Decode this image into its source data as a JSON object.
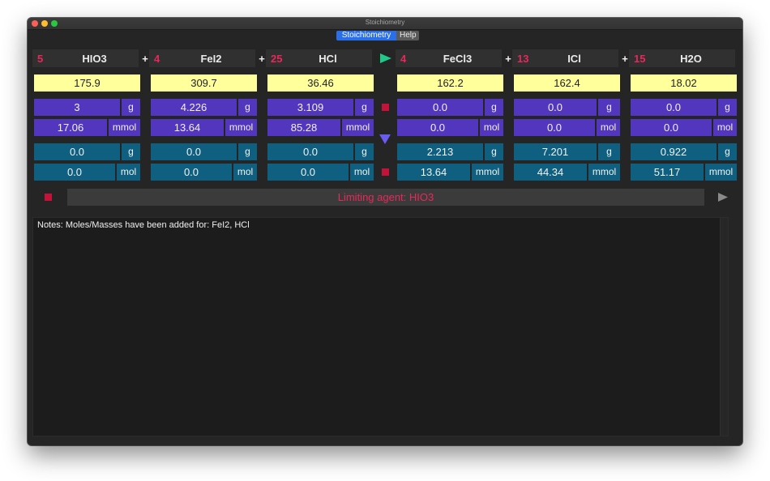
{
  "window": {
    "title": "Stoichiometry"
  },
  "tabs": [
    {
      "label": "Stoichiometry",
      "active": true
    },
    {
      "label": "Help",
      "active": false
    }
  ],
  "plus_sign": "+",
  "reactants": [
    {
      "coef": "5",
      "formula": "HIO3",
      "mw": "175.9",
      "mass": "3",
      "mass_unit": "g",
      "moles": "17.06",
      "moles_unit": "mmol",
      "calc_mass": "0.0",
      "calc_mass_unit": "g",
      "calc_moles": "0.0",
      "calc_moles_unit": "mol"
    },
    {
      "coef": "4",
      "formula": "FeI2",
      "mw": "309.7",
      "mass": "4.226",
      "mass_unit": "g",
      "moles": "13.64",
      "moles_unit": "mmol",
      "calc_mass": "0.0",
      "calc_mass_unit": "g",
      "calc_moles": "0.0",
      "calc_moles_unit": "mol"
    },
    {
      "coef": "25",
      "formula": "HCl",
      "mw": "36.46",
      "mass": "3.109",
      "mass_unit": "g",
      "moles": "85.28",
      "moles_unit": "mmol",
      "calc_mass": "0.0",
      "calc_mass_unit": "g",
      "calc_moles": "0.0",
      "calc_moles_unit": "mol"
    }
  ],
  "products": [
    {
      "coef": "4",
      "formula": "FeCl3",
      "mw": "162.2",
      "mass": "0.0",
      "mass_unit": "g",
      "moles": "0.0",
      "moles_unit": "mol",
      "calc_mass": "2.213",
      "calc_mass_unit": "g",
      "calc_moles": "13.64",
      "calc_moles_unit": "mmol"
    },
    {
      "coef": "13",
      "formula": "ICl",
      "mw": "162.4",
      "mass": "0.0",
      "mass_unit": "g",
      "moles": "0.0",
      "moles_unit": "mol",
      "calc_mass": "7.201",
      "calc_mass_unit": "g",
      "calc_moles": "44.34",
      "calc_moles_unit": "mmol"
    },
    {
      "coef": "15",
      "formula": "H2O",
      "mw": "18.02",
      "mass": "0.0",
      "mass_unit": "g",
      "moles": "0.0",
      "moles_unit": "mol",
      "calc_mass": "0.922",
      "calc_mass_unit": "g",
      "calc_moles": "51.17",
      "calc_moles_unit": "mmol"
    }
  ],
  "status": {
    "limiting_agent": "Limiting agent: HIO3"
  },
  "notes": {
    "text": "Notes: Moles/Masses have been added for: FeI2, HCl"
  },
  "colors": {
    "coefficient": "#e8285a",
    "input_cells": "#5236bd",
    "result_cells": "#0e5f80",
    "molar_mass": "#ffff9c",
    "run_arrow": "#1ec98a",
    "down_arrow": "#6a5cf0",
    "stop": "#c4123a"
  },
  "icons": {
    "run": "play-triangle-right",
    "calculate_down": "triangle-down",
    "stop": "square",
    "next": "play-triangle-right-gray"
  }
}
